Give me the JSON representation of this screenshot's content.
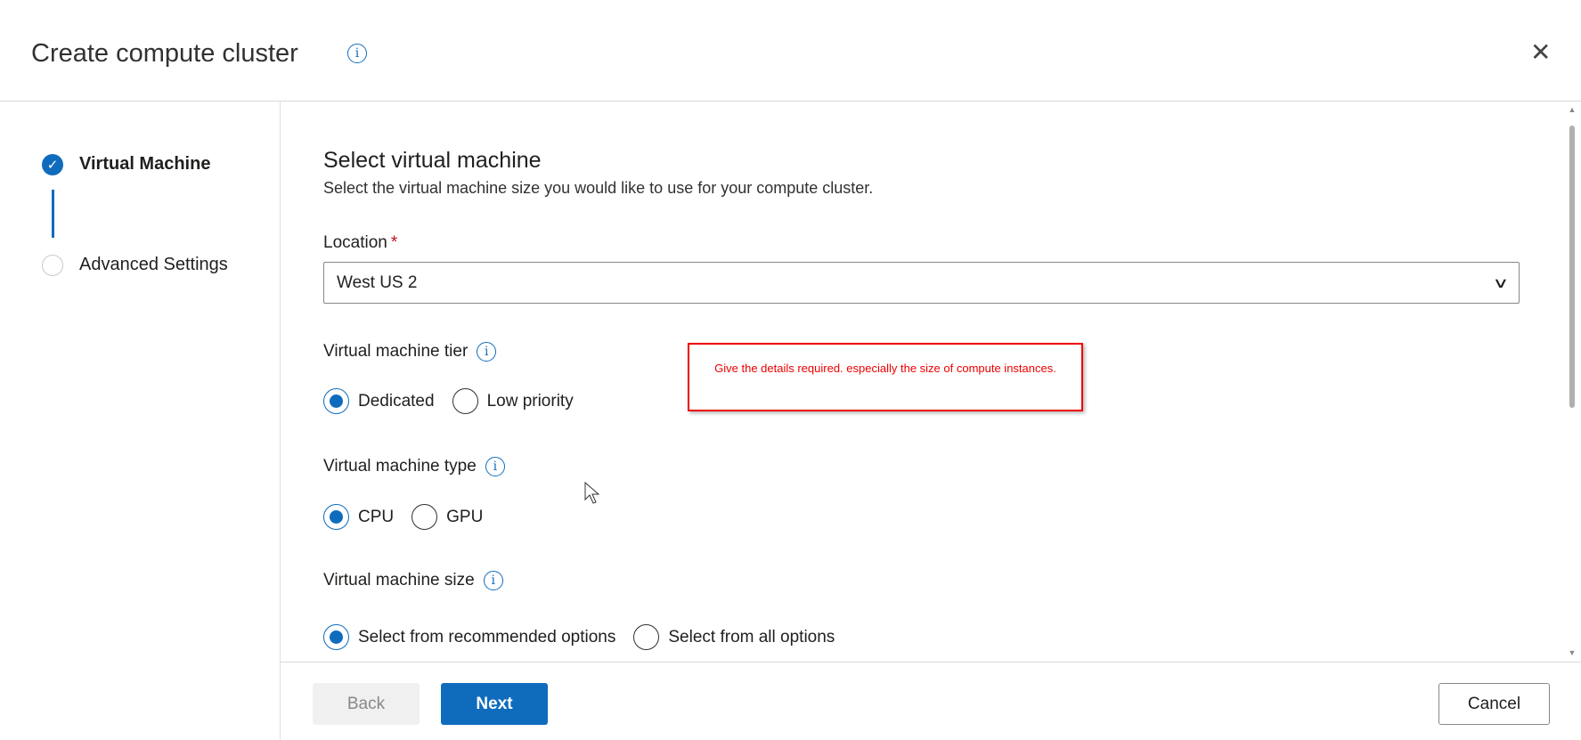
{
  "dialog": {
    "title": "Create compute cluster",
    "close_icon": "close-icon",
    "info_icon": "info-icon"
  },
  "steps": [
    {
      "label": "Virtual Machine",
      "state": "completed"
    },
    {
      "label": "Advanced Settings",
      "state": "pending"
    }
  ],
  "section": {
    "title": "Select virtual machine",
    "subtitle": "Select the virtual machine size you would like to use for your compute cluster."
  },
  "location": {
    "label": "Location",
    "required_mark": "*",
    "value": "West US 2"
  },
  "tier": {
    "label": "Virtual machine tier",
    "options": [
      "Dedicated",
      "Low priority"
    ],
    "selected": "Dedicated"
  },
  "type": {
    "label": "Virtual machine type",
    "options": [
      "CPU",
      "GPU"
    ],
    "selected": "CPU"
  },
  "size": {
    "label": "Virtual machine size",
    "options": [
      "Select from recommended options",
      "Select from all options"
    ],
    "selected": "Select from recommended options"
  },
  "annotation": "Give the details required. especially the size of compute instances.",
  "footer": {
    "back": "Back",
    "next": "Next",
    "cancel": "Cancel"
  },
  "colors": {
    "accent": "#0f6cbd",
    "annotation": "#ee0000"
  }
}
